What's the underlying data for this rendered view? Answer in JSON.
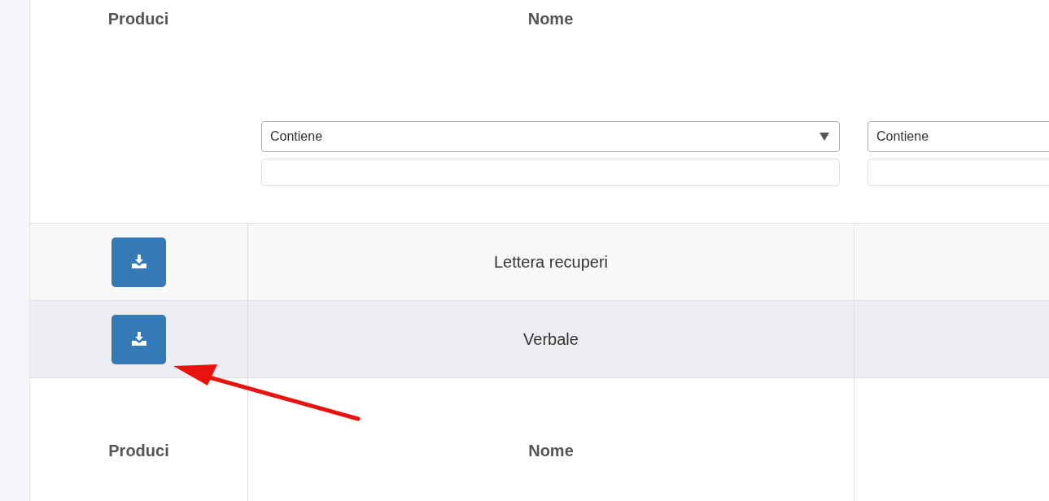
{
  "header_labels": [
    "Produci",
    "Nome"
  ],
  "filters": [
    {
      "operator": "Contiene",
      "show_caret": true
    },
    {
      "operator": "Contiene"
    }
  ],
  "rows": [
    {
      "name": "Lettera recuperi",
      "selected": false
    },
    {
      "name": "Verbale",
      "selected": true
    }
  ],
  "footer_labels": [
    "Produci",
    "Nome"
  ]
}
